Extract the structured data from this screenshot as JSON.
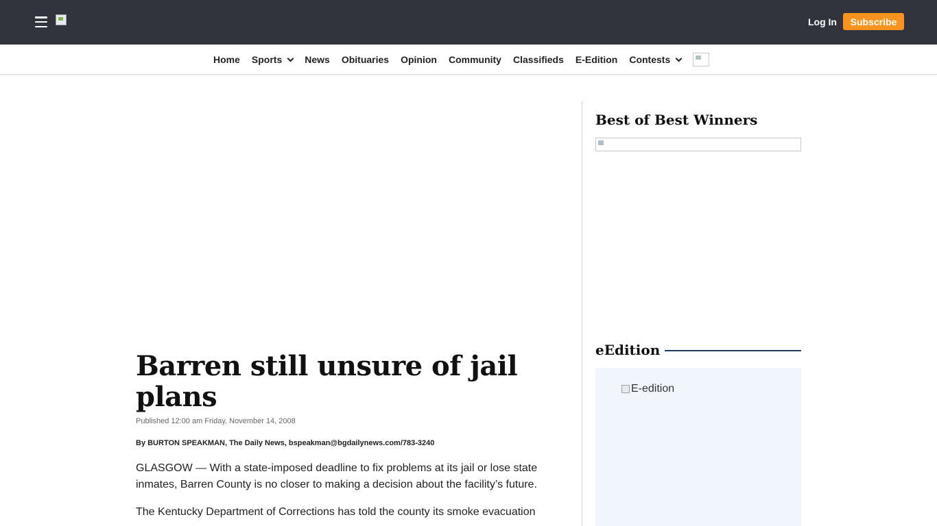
{
  "header": {
    "menu_icon": "hamburger-menu-icon",
    "logo_icon": "broken-image-icon",
    "login_label": "Log In",
    "subscribe_label": "Subscribe",
    "subscribe_color": "#f7931e",
    "bar_color": "#30333c"
  },
  "nav": {
    "items": [
      {
        "label": "Home",
        "dropdown": false
      },
      {
        "label": "Sports",
        "dropdown": true
      },
      {
        "label": "News",
        "dropdown": false
      },
      {
        "label": "Obituaries",
        "dropdown": false
      },
      {
        "label": "Opinion",
        "dropdown": false
      },
      {
        "label": "Community",
        "dropdown": false
      },
      {
        "label": "Classifieds",
        "dropdown": false
      },
      {
        "label": "E-Edition",
        "dropdown": false
      },
      {
        "label": "Contests",
        "dropdown": true
      }
    ]
  },
  "article": {
    "headline": "Barren still unsure of jail plans",
    "published": "Published 12:00 am Friday, November 14, 2008",
    "byline": "By BURTON SPEAKMAN, The Daily News, bspeakman@bgdailynews.com/783-3240",
    "paragraphs": [
      "GLASGOW — With a state-imposed deadline to fix problems at its jail or lose state inmates, Barren County is no closer to making a decision about the facility’s future.",
      "The Kentucky Department of Corrections has told the county its smoke evacuation"
    ]
  },
  "sidebar": {
    "best_title": "Best of Best Winners",
    "edition_title": "eEdition",
    "edition_alt": "E-edition",
    "edition_rule_color": "#1f3a5f",
    "edition_bg": "#f1f6fc"
  }
}
